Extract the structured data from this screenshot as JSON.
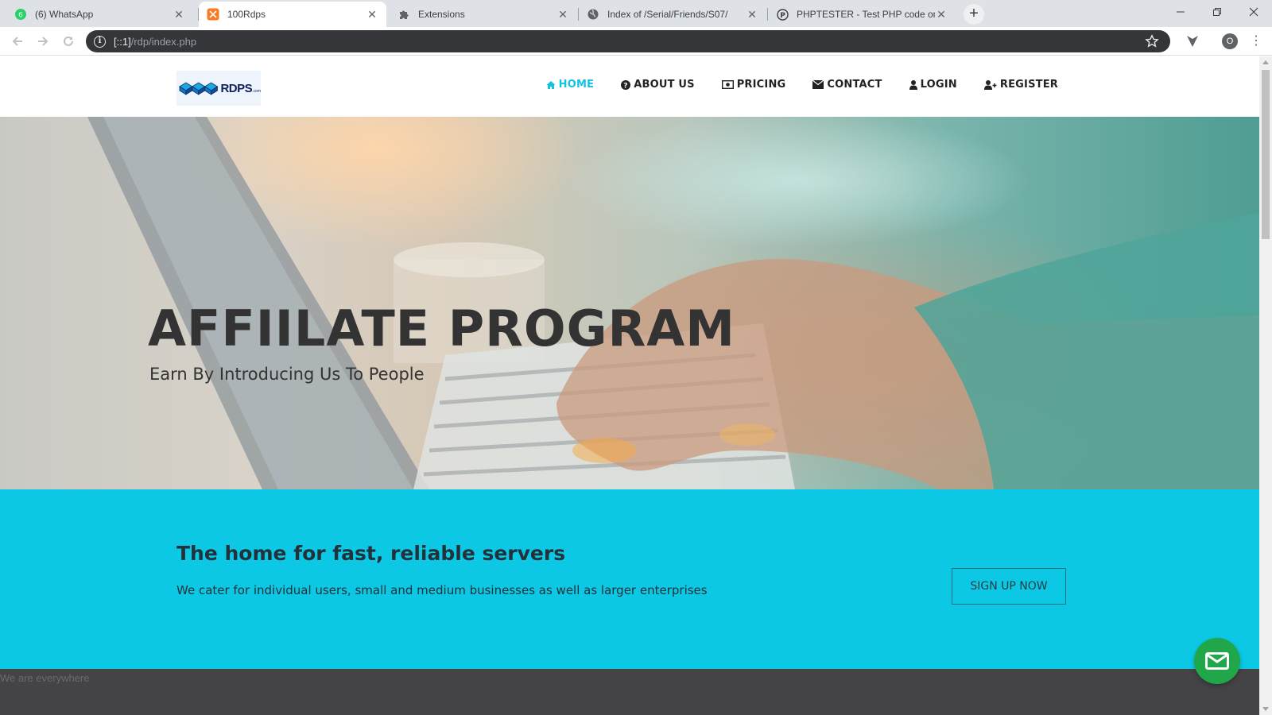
{
  "browser": {
    "tabs": [
      {
        "title": "(6) WhatsApp",
        "icon": "whatsapp-icon",
        "active": false
      },
      {
        "title": "100Rdps",
        "icon": "xampp-icon",
        "active": true
      },
      {
        "title": "Extensions",
        "icon": "puzzle-icon",
        "active": false
      },
      {
        "title": "Index of /Serial/Friends/S07/",
        "icon": "globe-icon",
        "active": false
      },
      {
        "title": "PHPTESTER - Test PHP code onlin",
        "icon": "phptester-icon",
        "active": false
      }
    ],
    "whatsapp_badge": "6",
    "url_host": "[::1]",
    "url_path": "/rdp/index.php",
    "profile_initial": "O"
  },
  "site": {
    "logo_text": "RDPS",
    "logo_sub": ".com",
    "nav": [
      {
        "label": "HOME",
        "icon": "home-icon",
        "active": true
      },
      {
        "label": "ABOUT US",
        "icon": "question-circle-icon",
        "active": false
      },
      {
        "label": "PRICING",
        "icon": "money-icon",
        "active": false
      },
      {
        "label": "CONTACT",
        "icon": "envelope-icon",
        "active": false
      },
      {
        "label": "LOGIN",
        "icon": "user-icon",
        "active": false
      },
      {
        "label": "REGISTER",
        "icon": "user-plus-icon",
        "active": false
      }
    ],
    "hero": {
      "title": "AFFIILATE PROGRAM",
      "subtitle": "Earn By Introducing Us To People"
    },
    "cta": {
      "title": "The home for fast, reliable servers",
      "text": "We cater for individual users, small and medium businesses as well as larger enterprises",
      "button": "SIGN UP NOW"
    },
    "footer_text": "We are everywhere"
  },
  "colors": {
    "accent": "#13c1e3",
    "cta_band": "#0cc8e4",
    "footer_band": "#444446",
    "chat_button": "#1fa74a"
  }
}
